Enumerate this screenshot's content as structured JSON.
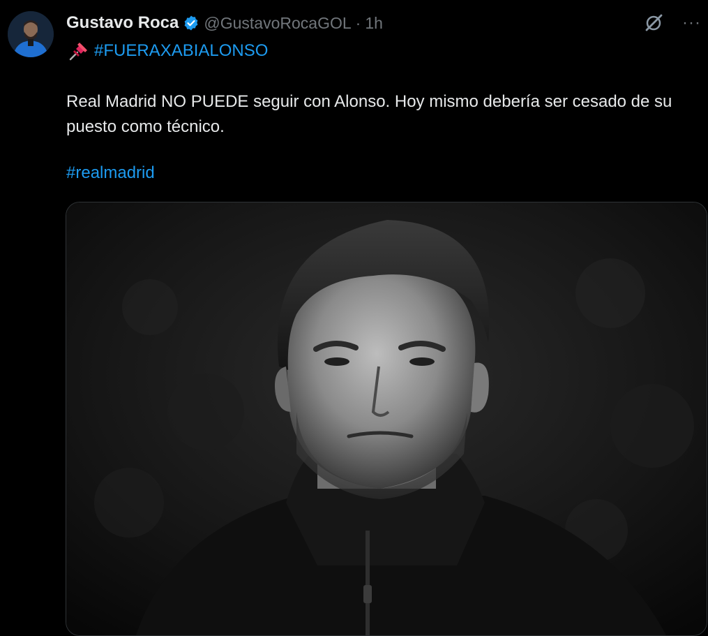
{
  "tweet": {
    "author_name": "Gustavo Roca",
    "handle": "@GustavoRocaGOL",
    "separator": "·",
    "time": "1h",
    "pinned_hashtag": "#FUERAXABIALONSO",
    "text": "Real Madrid NO PUEDE seguir con Alonso. Hoy mismo debería ser cesado de su puesto como técnico.",
    "hashtag": "#realmadrid",
    "more_label": "···"
  },
  "icons": {
    "verified": "verified-badge-icon",
    "pin": "pushpin-icon",
    "grok": "grok-icon",
    "more": "more-options-icon"
  },
  "colors": {
    "background": "#000000",
    "link": "#1d9bf0",
    "secondary_text": "#71767b",
    "primary_text": "#e7e9ea",
    "verified": "#1d9bf0"
  }
}
